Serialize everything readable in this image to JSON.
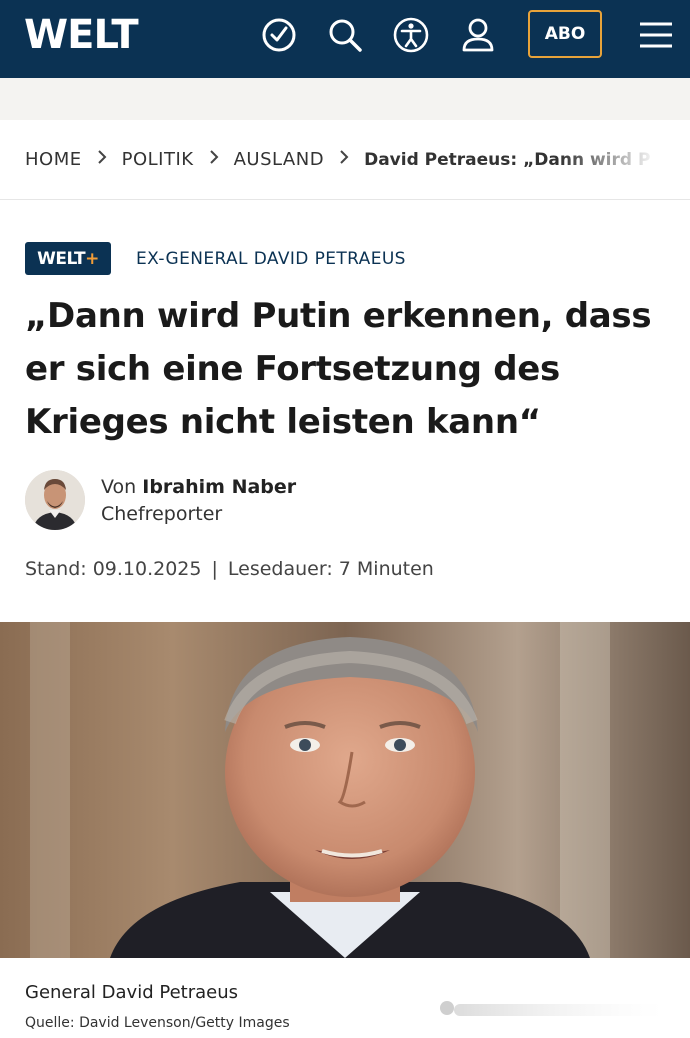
{
  "header": {
    "logo": "WELT",
    "abo_label": "ABO",
    "icons": [
      "clock-check-icon",
      "search-icon",
      "accessibility-icon",
      "user-icon",
      "menu-icon"
    ],
    "background_color": "#0b3253",
    "accent_color": "#e8a33a"
  },
  "breadcrumb": {
    "items": [
      "HOME",
      "POLITIK",
      "AUSLAND"
    ],
    "current": "David Petraeus: „Dann wird P"
  },
  "article": {
    "badge": {
      "text": "WELT",
      "plus": "+"
    },
    "kicker": "EX-GENERAL DAVID PETRAEUS",
    "headline_lines": [
      "„Dann wird Putin erkennen, dass",
      "er sich eine Fortsetzung des",
      "Krieges nicht leisten kann“"
    ],
    "author": {
      "prefix": "Von",
      "name": "Ibrahim Naber",
      "role": "Chefreporter"
    },
    "stand": "Stand: 09.10.2025",
    "separator": "|",
    "reading_time": "Lesedauer: 7 Minuten",
    "image": {
      "caption": "General David Petraeus",
      "source": "Quelle: David Levenson/Getty Images"
    }
  }
}
